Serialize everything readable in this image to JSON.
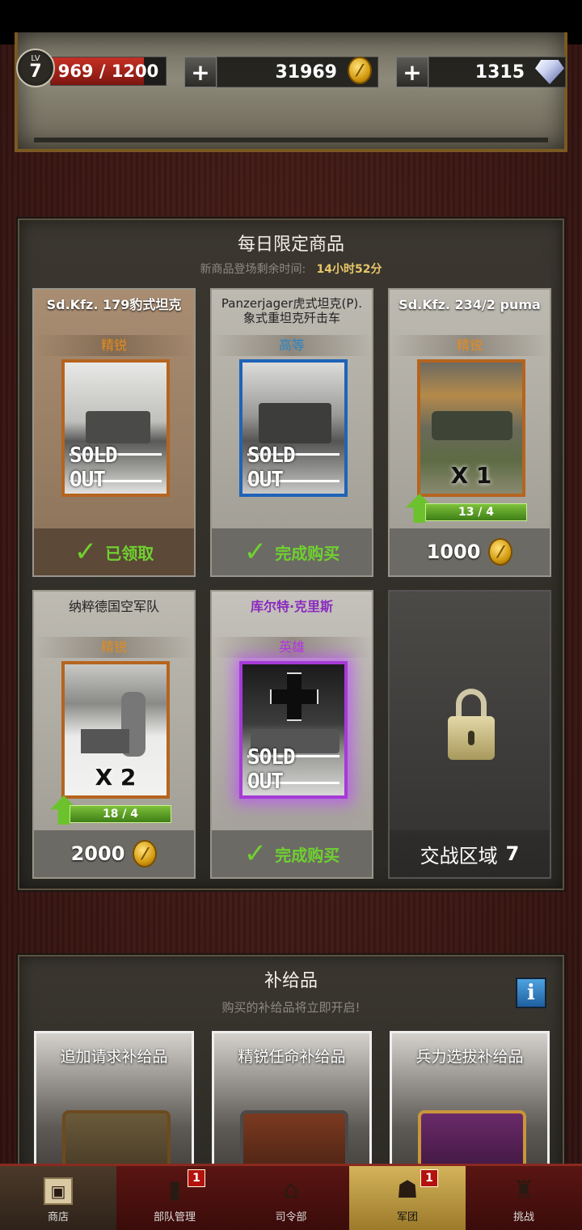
{
  "hud": {
    "level_label": "LV",
    "level": "7",
    "xp_text": "969 / 1200",
    "xp_progress": 0.8075,
    "plus": "+",
    "gold": "31969",
    "gems": "1315"
  },
  "daily": {
    "title": "每日限定商品",
    "countdown_label": "新商品登场剩余时间:",
    "countdown_value": "14小时52分",
    "cards": [
      {
        "name": "Sd.Kfz. 179豹式坦克",
        "rank": "精锐",
        "overlay": "SOLD OUT",
        "footer": "已领取",
        "icon": "check-icon"
      },
      {
        "name": "Panzerjager虎式坦克(P). 象式重坦克歼击车",
        "rank": "高等",
        "overlay": "SOLD OUT",
        "footer": "完成购买",
        "icon": "check-icon"
      },
      {
        "name": "Sd.Kfz. 234/2 puma",
        "rank": "精锐",
        "multiplier": "X 1",
        "progress": "13 / 4",
        "price": "1000",
        "icon": "coin-icon"
      },
      {
        "name": "纳粹德国空军队",
        "rank": "精锐",
        "multiplier": "X 2",
        "progress": "18 / 4",
        "price": "2000",
        "icon": "coin-icon"
      },
      {
        "name": "库尔特·克里斯",
        "rank": "英雄",
        "overlay": "SOLD OUT",
        "footer": "完成购买",
        "icon": "check-icon"
      },
      {
        "zone_label": "交战区域",
        "zone_number": "7",
        "icon": "lock-icon"
      }
    ]
  },
  "supply": {
    "title": "补给品",
    "subtitle": "购买的补给品将立即开启!",
    "info": "i",
    "items": [
      {
        "label": "追加请求补给品"
      },
      {
        "label": "精锐任命补给品"
      },
      {
        "label": "兵力选拔补给品"
      }
    ]
  },
  "nav": {
    "items": [
      {
        "label": "商店",
        "icon": "box-icon"
      },
      {
        "label": "部队管理",
        "icon": "book-icon",
        "badge": "1"
      },
      {
        "label": "司令部",
        "icon": "hq-icon"
      },
      {
        "label": "军团",
        "icon": "group-icon",
        "badge": "1"
      },
      {
        "label": "挑战",
        "icon": "trophy-icon"
      }
    ]
  },
  "colors": {
    "background": "#3a1714",
    "gold": "#e7c66a",
    "elite": "#e38b1d",
    "high": "#2a84c4",
    "heroic": "#b531e0",
    "done_green": "#6fd130",
    "nav_active": "#d3b35a"
  }
}
